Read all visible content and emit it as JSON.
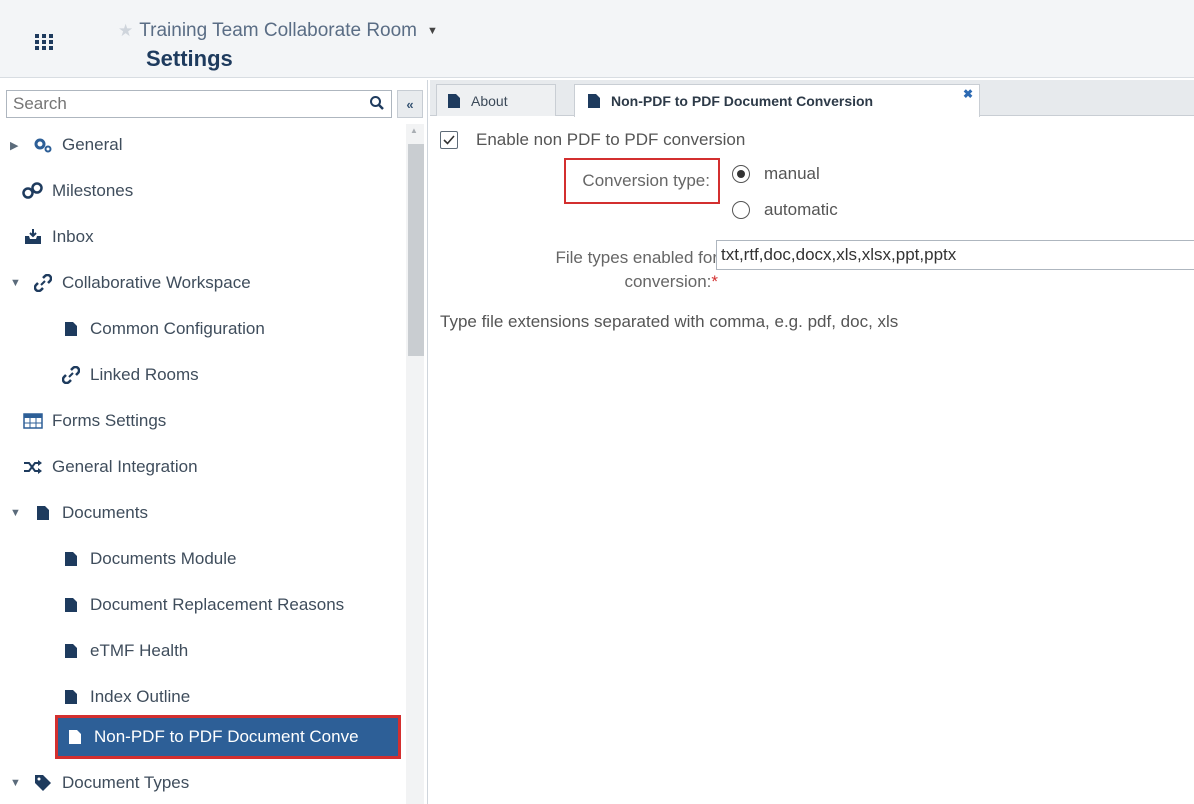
{
  "header": {
    "room_title": "Training Team Collaborate Room",
    "page_title": "Settings"
  },
  "sidebar": {
    "search_placeholder": "Search",
    "items": [
      {
        "label": "General"
      },
      {
        "label": "Milestones"
      },
      {
        "label": "Inbox"
      },
      {
        "label": "Collaborative Workspace"
      },
      {
        "label": "Common Configuration"
      },
      {
        "label": "Linked Rooms"
      },
      {
        "label": "Forms Settings"
      },
      {
        "label": "General Integration"
      },
      {
        "label": "Documents"
      },
      {
        "label": "Documents Module"
      },
      {
        "label": "Document Replacement Reasons"
      },
      {
        "label": "eTMF Health"
      },
      {
        "label": "Index Outline"
      },
      {
        "label": "Non-PDF to PDF Document Conve"
      },
      {
        "label": "Document Types"
      }
    ]
  },
  "tabs": [
    {
      "label": "About"
    },
    {
      "label": "Non-PDF to PDF Document Conversion"
    }
  ],
  "form": {
    "enable_label": "Enable non PDF to PDF conversion",
    "conversion_type_label": "Conversion type:",
    "radio_manual": "manual",
    "radio_automatic": "automatic",
    "file_types_label_line1": "File types enabled for",
    "file_types_label_line2": "conversion:",
    "required_mark": "*",
    "file_types_value": "txt,rtf,doc,docx,xls,xlsx,ppt,pptx",
    "hint": "Type file extensions separated with comma, e.g. pdf, doc, xls"
  }
}
